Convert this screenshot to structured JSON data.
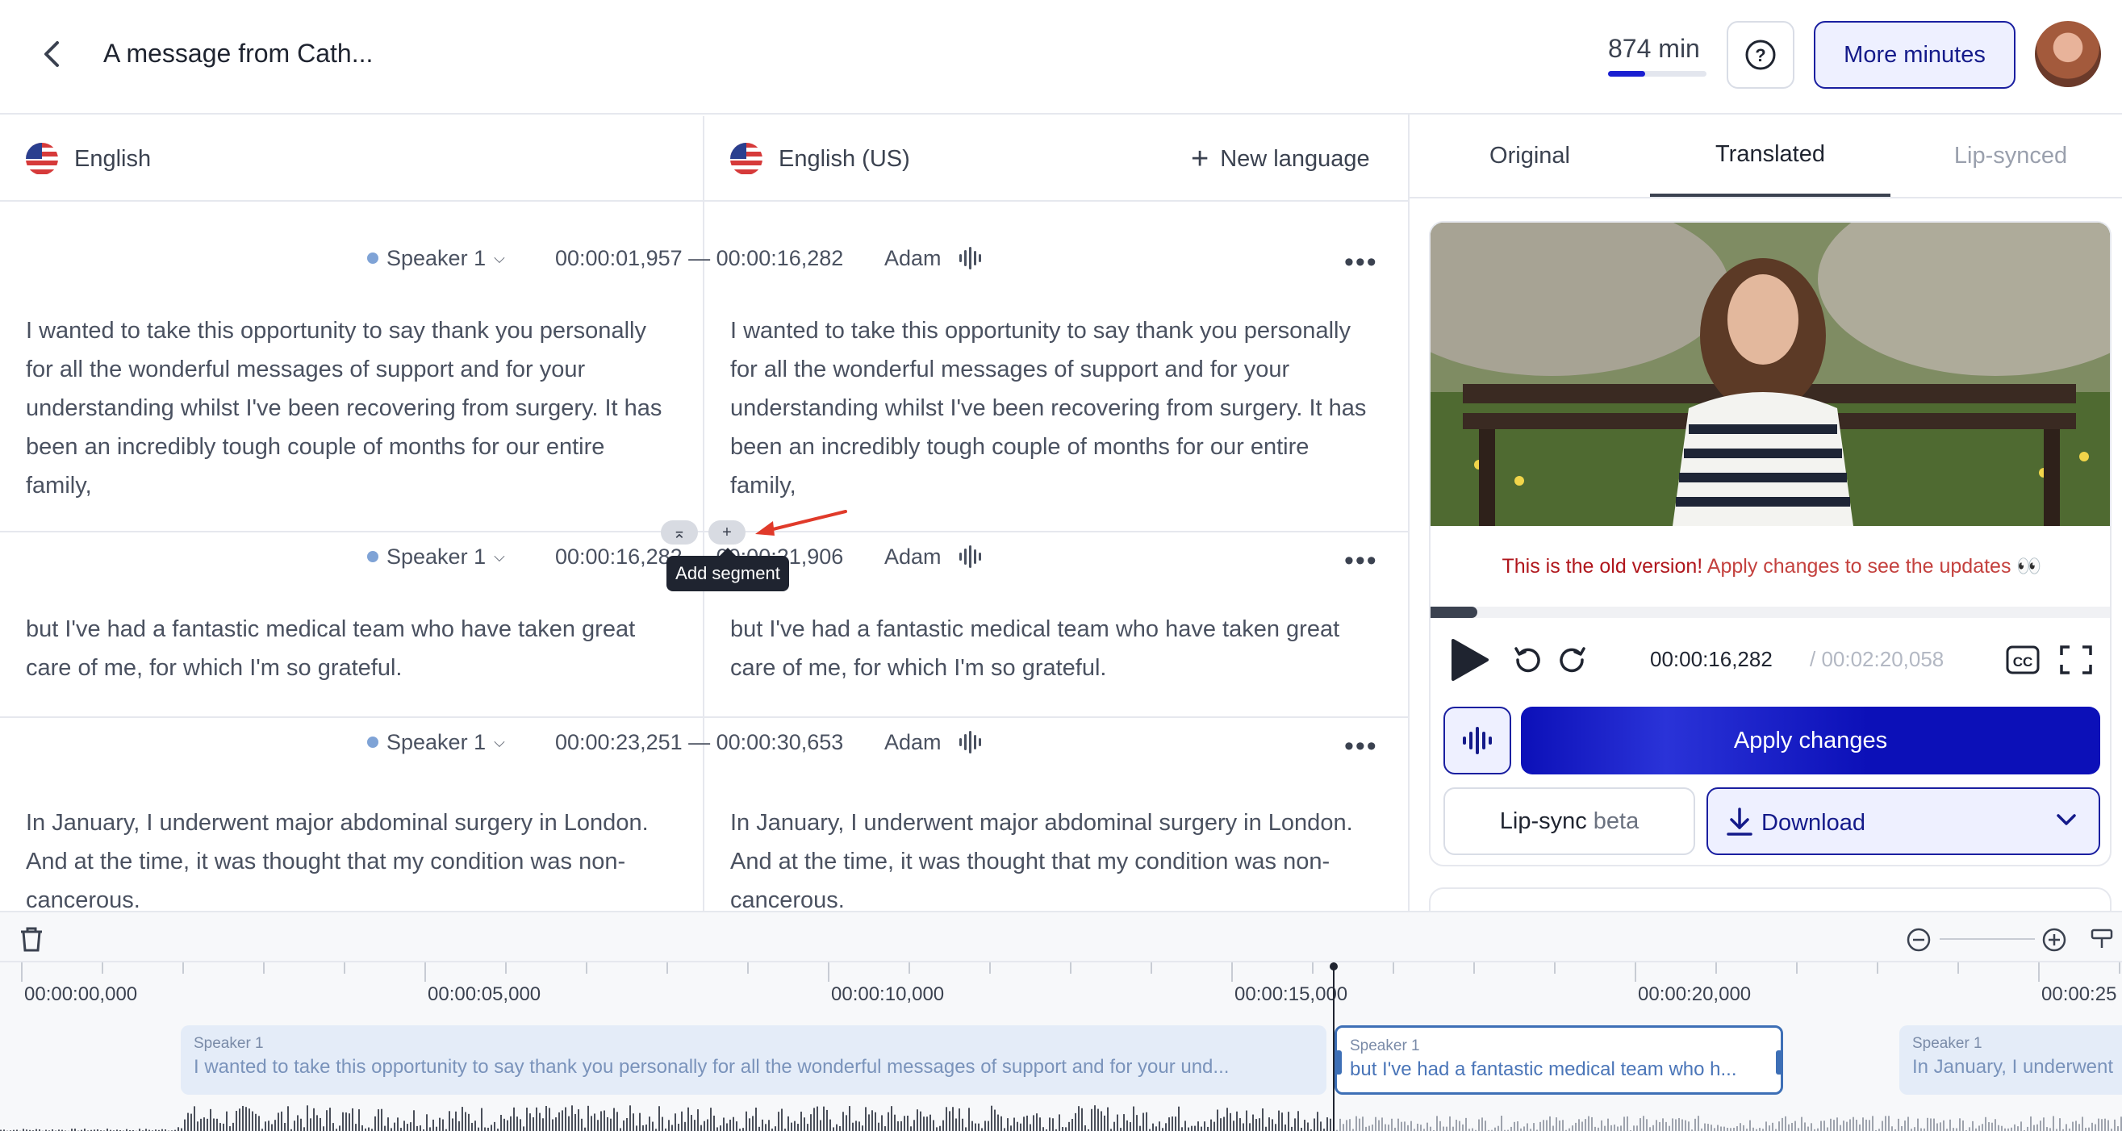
{
  "header": {
    "title": "A message from Cath...",
    "minutes_label": "874 min",
    "minutes_used_fraction": 0.38,
    "help_label": "?",
    "more_minutes_label": "More minutes"
  },
  "languages": {
    "source": "English",
    "target": "English (US)",
    "new_language": "New language"
  },
  "segments": [
    {
      "speaker": "Speaker 1",
      "time_range": "00:00:01,957 — 00:00:16,282",
      "voice": "Adam",
      "source_text": "I wanted to take this opportunity to say thank you personally for all the wonderful messages of support and for your understanding whilst I've been recovering from surgery. It has been an incredibly tough couple of months for our entire family,",
      "target_text": "I wanted to take this opportunity to say thank you personally for all the wonderful messages of support and for your understanding whilst I've been recovering from surgery. It has been an incredibly tough couple of months for our entire family,"
    },
    {
      "speaker": "Speaker 1",
      "time_range": "00:00:16,282 — 00:00:21,906",
      "voice": "Adam",
      "source_text": "but I've had a fantastic medical team who have taken great care of me, for which I'm so grateful.",
      "target_text": "but I've had a fantastic medical team who have taken great care of me, for which I'm so grateful."
    },
    {
      "speaker": "Speaker 1",
      "time_range": "00:00:23,251 — 00:00:30,653",
      "voice": "Adam",
      "source_text": "In January, I underwent major abdominal surgery in London. And at the time, it was thought that my condition was non-cancerous.",
      "target_text": "In January, I underwent major abdominal surgery in London. And at the time, it was thought that my condition was non-cancerous."
    }
  ],
  "add_segment": {
    "tooltip": "Add segment",
    "plus": "+",
    "collapse": "⌅"
  },
  "player": {
    "tabs": [
      "Original",
      "Translated",
      "Lip-synced"
    ],
    "active_tab": "Translated",
    "warning_strong": "This is the old version!",
    "warning_soft": "Apply changes to see the updates 👀",
    "progress_fraction": 0.069,
    "current_time": "00:00:16,282",
    "total_time": "/ 00:02:20,058",
    "cc_label": "CC",
    "apply_changes": "Apply changes",
    "lipsync_label": "Lip-sync",
    "lipsync_badge": "beta",
    "download_label": "Download"
  },
  "timeline": {
    "ticks": [
      "00:00:00,000",
      "00:00:05,000",
      "00:00:10,000",
      "00:00:15,000",
      "00:00:20,000",
      "00:00:25"
    ],
    "clips": [
      {
        "speaker": "Speaker 1",
        "text": "I wanted to take this opportunity to say thank you personally for all the wonderful messages of support and for your und..."
      },
      {
        "speaker": "Speaker 1",
        "text": "but I've had a fantastic medical team who h..."
      },
      {
        "speaker": "Speaker 1",
        "text": "In January, I underwent"
      }
    ]
  },
  "colors": {
    "accent": "#1a1fd1",
    "accent_dark": "#141a8a",
    "warning": "#b0161c",
    "clip_bg": "#e4ecf8",
    "clip_selected": "#3d6fb6"
  },
  "icons": {
    "back": "chevron-left-icon",
    "help": "question-circle-icon",
    "voice": "waveform-icon",
    "more": "more-horizontal-icon",
    "play": "play-icon",
    "rewind": "rotate-ccw-icon",
    "forward": "rotate-cw-icon",
    "captions": "cc-icon",
    "fullscreen": "fullscreen-icon",
    "download": "download-icon",
    "trash": "trash-icon",
    "zoom_out": "zoom-out-icon",
    "zoom_in": "zoom-in-icon"
  }
}
